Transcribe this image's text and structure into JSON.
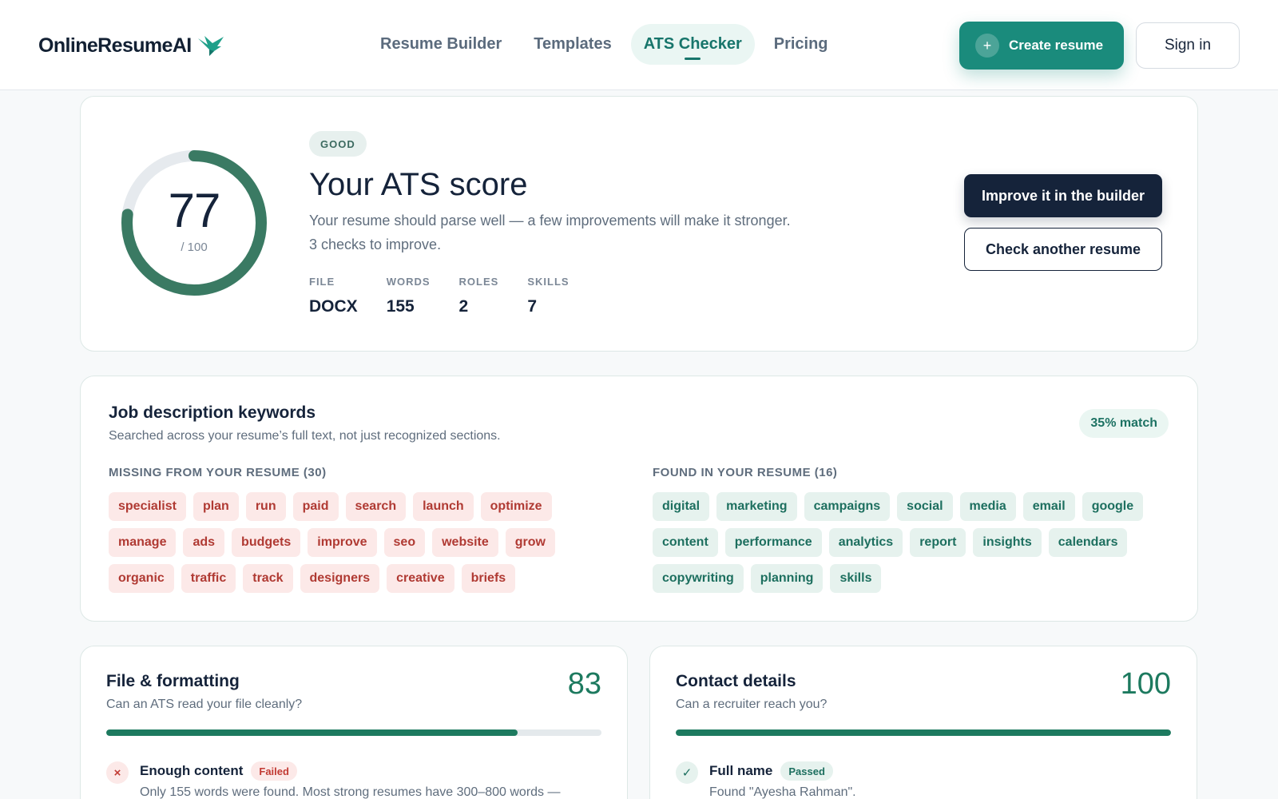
{
  "header": {
    "logo_text": "OnlineResumeAI",
    "nav": [
      {
        "label": "Resume Builder",
        "active": false
      },
      {
        "label": "Templates",
        "active": false
      },
      {
        "label": "ATS Checker",
        "active": true
      },
      {
        "label": "Pricing",
        "active": false
      }
    ],
    "create_label": "Create resume",
    "create_icon": "+",
    "signin_label": "Sign in"
  },
  "score": {
    "value": "77",
    "max_label": "/ 100",
    "fraction": 0.77,
    "badge": "GOOD",
    "title": "Your ATS score",
    "description": "Your resume should parse well — a few improvements will make it stronger.",
    "checks_note": "3 checks to improve.",
    "stats": [
      {
        "label": "FILE",
        "value": "DOCX"
      },
      {
        "label": "WORDS",
        "value": "155"
      },
      {
        "label": "ROLES",
        "value": "2"
      },
      {
        "label": "SKILLS",
        "value": "7"
      }
    ],
    "improve_label": "Improve it in the builder",
    "check_another_label": "Check another resume"
  },
  "keywords": {
    "title": "Job description keywords",
    "subtitle": "Searched across your resume’s full text, not just recognized sections.",
    "match_label": "35% match",
    "missing_heading": "MISSING FROM YOUR RESUME (30)",
    "missing": [
      "specialist",
      "plan",
      "run",
      "paid",
      "search",
      "launch",
      "optimize",
      "manage",
      "ads",
      "budgets",
      "improve",
      "seo",
      "website",
      "grow",
      "organic",
      "traffic",
      "track",
      "designers",
      "creative",
      "briefs"
    ],
    "found_heading": "FOUND IN YOUR RESUME (16)",
    "found": [
      "digital",
      "marketing",
      "campaigns",
      "social",
      "media",
      "email",
      "google",
      "content",
      "performance",
      "analytics",
      "report",
      "insights",
      "calendars",
      "copywriting",
      "planning",
      "skills"
    ]
  },
  "sections": [
    {
      "title": "File & formatting",
      "subtitle": "Can an ATS read your file cleanly?",
      "score": "83",
      "fraction": 0.83,
      "check": {
        "name": "Enough content",
        "status": "Failed",
        "icon": "×",
        "detail": "Only 155 words were found. Most strong resumes have 300–800 words —"
      }
    },
    {
      "title": "Contact details",
      "subtitle": "Can a recruiter reach you?",
      "score": "100",
      "fraction": 1.0,
      "check": {
        "name": "Full name",
        "status": "Passed",
        "icon": "✓",
        "detail": "Found \"Ayesha Rahman\"."
      }
    }
  ],
  "colors": {
    "accent": "#1a8b7c",
    "score_green": "#3a7a63",
    "navy": "#15233a",
    "fail_red": "#c23a33"
  }
}
